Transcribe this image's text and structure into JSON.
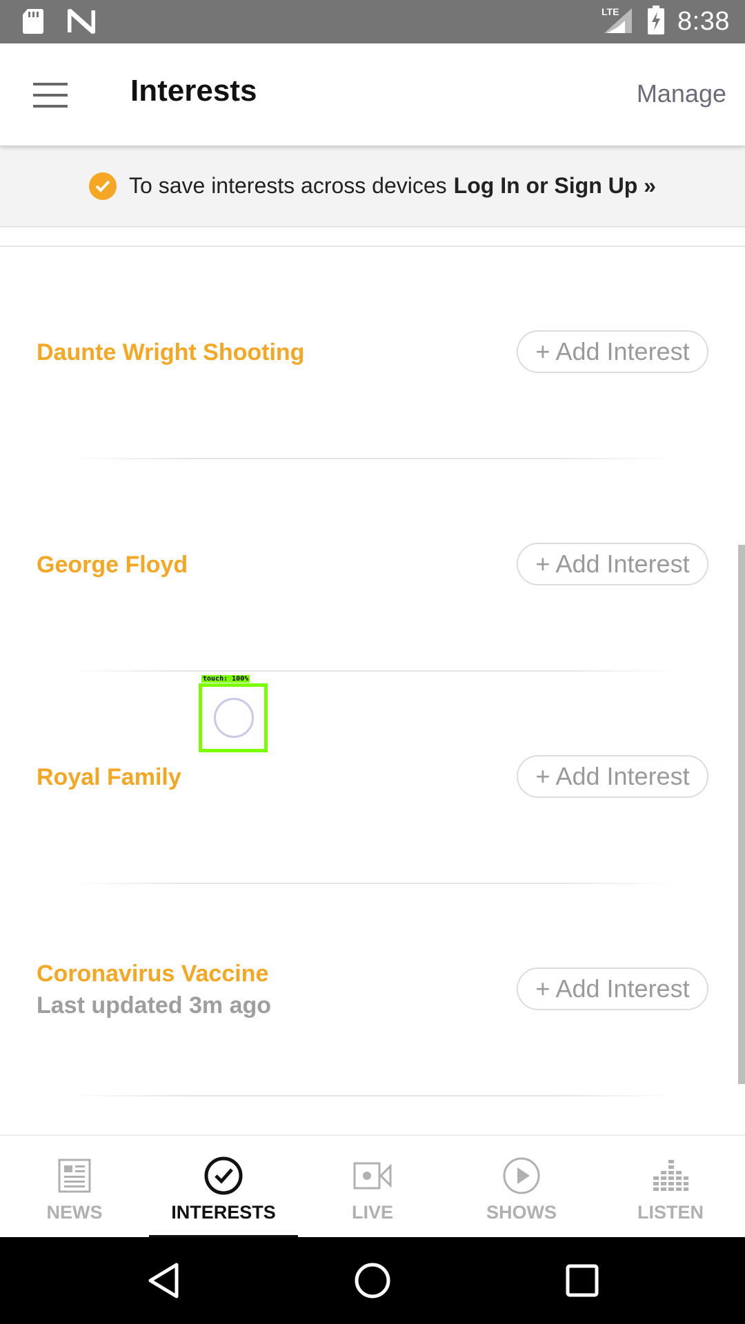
{
  "status_bar": {
    "time": "8:38",
    "network": "LTE",
    "icons": [
      "sd-card-icon",
      "n-logo-icon",
      "lte-signal-icon",
      "battery-charging-icon"
    ]
  },
  "app_bar": {
    "title": "Interests",
    "manage_label": "Manage",
    "menu_icon": "hamburger-menu-icon"
  },
  "banner": {
    "text": "To save interests across devices",
    "login_label": "Log In or Sign Up »",
    "check_color": "#f5a623"
  },
  "interests": [
    {
      "name": "Daunte Wright Shooting",
      "updated": "",
      "button": "+ Add Interest"
    },
    {
      "name": "George Floyd",
      "updated": "",
      "button": "+ Add Interest"
    },
    {
      "name": "Royal Family",
      "updated": "",
      "button": "+ Add Interest"
    },
    {
      "name": "Coronavirus Vaccine",
      "updated": "Last updated 3m ago",
      "button": "+ Add Interest"
    }
  ],
  "touch_overlay": {
    "label": "touch: 100%"
  },
  "bottom_nav": [
    {
      "label": "NEWS",
      "icon": "newspaper-icon",
      "active": false
    },
    {
      "label": "INTERESTS",
      "icon": "check-circle-icon",
      "active": true
    },
    {
      "label": "LIVE",
      "icon": "video-camera-icon",
      "active": false
    },
    {
      "label": "SHOWS",
      "icon": "play-circle-icon",
      "active": false
    },
    {
      "label": "LISTEN",
      "icon": "equalizer-icon",
      "active": false
    }
  ],
  "colors": {
    "accent": "#f5a623",
    "status_bar": "#757575",
    "inactive_nav": "#b0b0b0"
  }
}
